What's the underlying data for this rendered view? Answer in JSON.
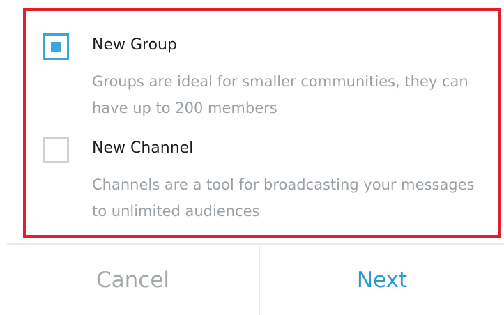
{
  "options": [
    {
      "title": "New Group",
      "description": "Groups are ideal for smaller communities, they can have up to 200 members",
      "checked": true
    },
    {
      "title": "New Channel",
      "description": "Channels are a tool for broadcasting your messages to unlimited audiences",
      "checked": false
    }
  ],
  "footer": {
    "cancel_label": "Cancel",
    "next_label": "Next"
  },
  "colors": {
    "accent": "#3aa6df",
    "highlight": "#e0202c"
  }
}
